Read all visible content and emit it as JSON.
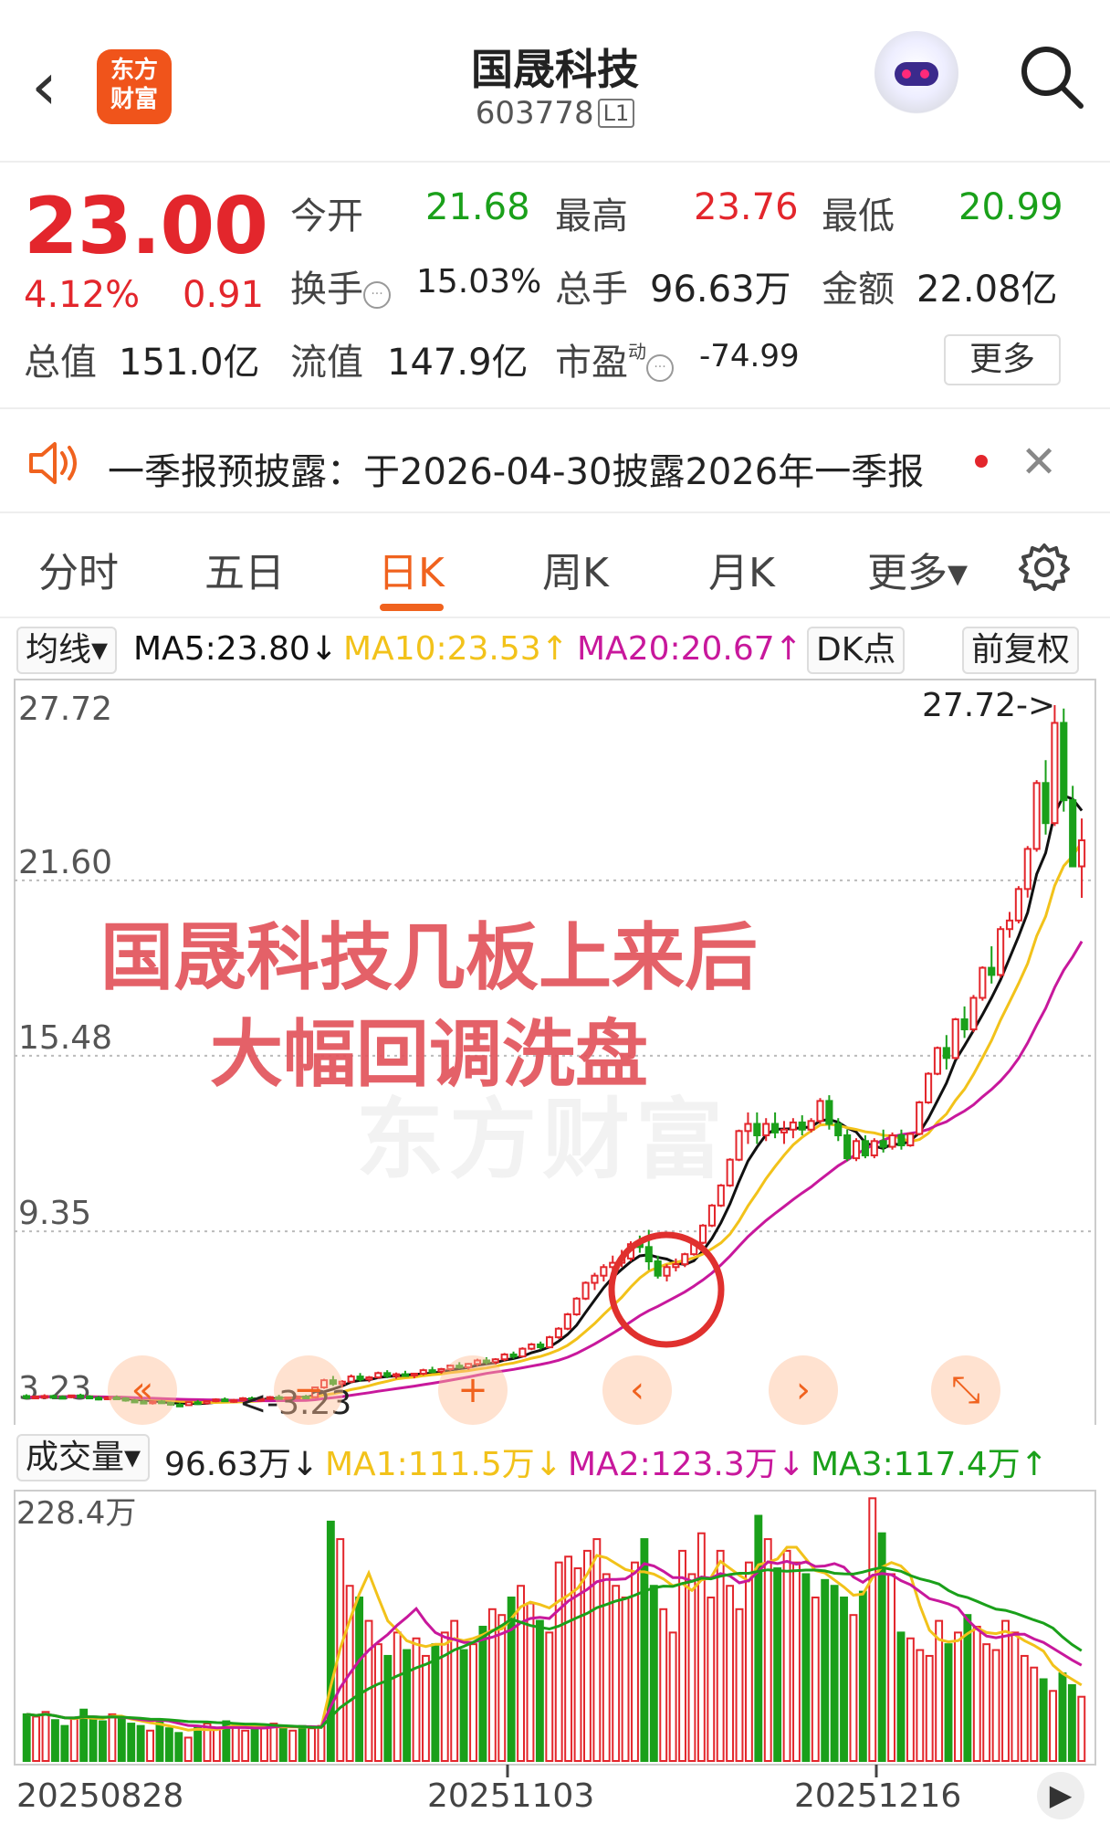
{
  "header": {
    "back_glyph": "‹",
    "logo_line1": "东方",
    "logo_line2": "财富",
    "title": "国晟科技",
    "code": "603778",
    "level": "L1"
  },
  "quote": {
    "price": "23.00",
    "change_pct": "4.12%",
    "change_amt": "0.91",
    "open_label": "今开",
    "open": "21.68",
    "high_label": "最高",
    "high": "23.76",
    "low_label": "最低",
    "low": "20.99",
    "turnover_label": "换手",
    "turnover": "15.03%",
    "volume_label": "总手",
    "volume": "96.63万",
    "amount_label": "金额",
    "amount": "22.08亿",
    "mktcap_label": "总值",
    "mktcap": "151.0亿",
    "float_label": "流值",
    "float_cap": "147.9亿",
    "pe_label": "市盈",
    "pe_sup": "动",
    "pe": "-74.99",
    "more_label": "更多"
  },
  "notice": {
    "text": "一季报预披露：于2026-04-30披露2026年一季报"
  },
  "tabs": [
    {
      "label": "分时"
    },
    {
      "label": "五日"
    },
    {
      "label": "日K"
    },
    {
      "label": "周K"
    },
    {
      "label": "月K"
    },
    {
      "label": "更多▾"
    }
  ],
  "ma_bar": {
    "avg_label": "均线▾",
    "ma5": "MA5:23.80↓",
    "ma10": "MA10:23.53↑",
    "ma20": "MA20:20.67↑",
    "dk": "DK点",
    "adjust": "前复权"
  },
  "vol_bar": {
    "label": "成交量▾",
    "vol": "96.63万↓",
    "ma1": "MA1:111.5万↓",
    "ma2": "MA2:123.3万↓",
    "ma3": "MA3:117.4万↑"
  },
  "colors": {
    "up": "#e3262c",
    "down": "#1aa01a",
    "ma5": "#111111",
    "ma10": "#f2c21a",
    "ma20": "#c8189c",
    "accent": "#f0621e"
  },
  "annotation": {
    "line1": "国晟科技几板上来后",
    "line2": "大幅回调洗盘"
  },
  "watermark": "东方财富",
  "controls": [
    "«",
    "−",
    "+",
    "‹",
    "›",
    "⤡"
  ],
  "chart_data": [
    {
      "type": "candlestick",
      "y_ticks": [
        "27.72",
        "21.60",
        "15.48",
        "9.35",
        "3.23"
      ],
      "ylim": [
        3.23,
        27.72
      ],
      "max_marker": "27.72->",
      "min_marker": "<-3.23",
      "x_ticks": [
        "20250828",
        "20251103",
        "20251216"
      ],
      "ohlc": [
        [
          3.6,
          3.66,
          3.48,
          3.55
        ],
        [
          3.55,
          3.62,
          3.5,
          3.58
        ],
        [
          3.58,
          3.66,
          3.52,
          3.6
        ],
        [
          3.6,
          3.65,
          3.54,
          3.57
        ],
        [
          3.57,
          3.62,
          3.5,
          3.56
        ],
        [
          3.56,
          3.64,
          3.52,
          3.62
        ],
        [
          3.62,
          3.68,
          3.55,
          3.58
        ],
        [
          3.58,
          3.63,
          3.5,
          3.54
        ],
        [
          3.54,
          3.6,
          3.45,
          3.5
        ],
        [
          3.5,
          3.58,
          3.46,
          3.55
        ],
        [
          3.55,
          3.62,
          3.48,
          3.52
        ],
        [
          3.52,
          3.56,
          3.4,
          3.44
        ],
        [
          3.44,
          3.5,
          3.36,
          3.4
        ],
        [
          3.4,
          3.46,
          3.32,
          3.37
        ],
        [
          3.37,
          3.44,
          3.3,
          3.41
        ],
        [
          3.41,
          3.46,
          3.33,
          3.36
        ],
        [
          3.36,
          3.4,
          3.26,
          3.3
        ],
        [
          3.3,
          3.36,
          3.23,
          3.28
        ],
        [
          3.28,
          3.4,
          3.26,
          3.38
        ],
        [
          3.38,
          3.46,
          3.32,
          3.35
        ],
        [
          3.35,
          3.44,
          3.3,
          3.42
        ],
        [
          3.42,
          3.52,
          3.38,
          3.48
        ],
        [
          3.48,
          3.55,
          3.4,
          3.44
        ],
        [
          3.44,
          3.5,
          3.36,
          3.46
        ],
        [
          3.46,
          3.56,
          3.42,
          3.52
        ],
        [
          3.52,
          3.58,
          3.44,
          3.47
        ],
        [
          3.47,
          3.54,
          3.4,
          3.5
        ],
        [
          3.5,
          3.6,
          3.46,
          3.56
        ],
        [
          3.56,
          3.64,
          3.5,
          3.52
        ],
        [
          3.52,
          3.58,
          3.46,
          3.55
        ],
        [
          3.55,
          3.62,
          3.5,
          3.58
        ],
        [
          3.58,
          3.64,
          3.52,
          3.56
        ],
        [
          3.56,
          3.9,
          3.54,
          3.9
        ],
        [
          3.9,
          4.2,
          3.85,
          4.15
        ],
        [
          4.15,
          4.3,
          3.95,
          4.02
        ],
        [
          4.02,
          4.15,
          3.9,
          4.1
        ],
        [
          4.1,
          4.35,
          4.05,
          4.28
        ],
        [
          4.28,
          4.4,
          4.1,
          4.18
        ],
        [
          4.18,
          4.3,
          4.08,
          4.25
        ],
        [
          4.25,
          4.45,
          4.2,
          4.4
        ],
        [
          4.4,
          4.5,
          4.22,
          4.3
        ],
        [
          4.3,
          4.42,
          4.2,
          4.36
        ],
        [
          4.36,
          4.48,
          4.28,
          4.32
        ],
        [
          4.32,
          4.4,
          4.22,
          4.38
        ],
        [
          4.38,
          4.55,
          4.32,
          4.5
        ],
        [
          4.5,
          4.62,
          4.4,
          4.46
        ],
        [
          4.46,
          4.58,
          4.38,
          4.54
        ],
        [
          4.54,
          4.7,
          4.48,
          4.66
        ],
        [
          4.66,
          4.78,
          4.55,
          4.6
        ],
        [
          4.6,
          4.75,
          4.52,
          4.72
        ],
        [
          4.72,
          4.9,
          4.65,
          4.84
        ],
        [
          4.84,
          4.95,
          4.7,
          4.78
        ],
        [
          4.78,
          4.92,
          4.7,
          4.88
        ],
        [
          4.88,
          5.1,
          4.82,
          5.05
        ],
        [
          5.05,
          5.15,
          4.9,
          4.98
        ],
        [
          4.98,
          5.3,
          4.95,
          5.25
        ],
        [
          5.25,
          5.45,
          5.2,
          5.4
        ],
        [
          5.4,
          5.5,
          5.22,
          5.3
        ],
        [
          5.3,
          5.7,
          5.28,
          5.65
        ],
        [
          5.65,
          6.0,
          5.6,
          5.95
        ],
        [
          5.95,
          6.5,
          5.9,
          6.45
        ],
        [
          6.45,
          7.05,
          6.4,
          7.0
        ],
        [
          7.0,
          7.6,
          6.95,
          7.55
        ],
        [
          7.55,
          7.9,
          7.3,
          7.8
        ],
        [
          7.8,
          8.2,
          7.6,
          8.1
        ],
        [
          8.1,
          8.5,
          7.85,
          8.25
        ],
        [
          8.25,
          8.7,
          8.1,
          8.4
        ],
        [
          8.4,
          9.0,
          8.3,
          8.9
        ],
        [
          8.9,
          9.2,
          8.6,
          8.8
        ],
        [
          8.8,
          9.4,
          8.0,
          8.3
        ],
        [
          8.3,
          8.5,
          7.7,
          7.8
        ],
        [
          7.8,
          8.2,
          7.6,
          8.1
        ],
        [
          8.1,
          8.4,
          7.95,
          8.2
        ],
        [
          8.2,
          8.6,
          8.1,
          8.55
        ],
        [
          8.55,
          9.0,
          8.5,
          8.95
        ],
        [
          8.95,
          9.6,
          8.9,
          9.55
        ],
        [
          9.55,
          10.3,
          9.5,
          10.25
        ],
        [
          10.25,
          11.0,
          10.2,
          10.95
        ],
        [
          10.95,
          11.9,
          10.9,
          11.85
        ],
        [
          11.85,
          12.9,
          11.8,
          12.85
        ],
        [
          12.85,
          13.5,
          12.4,
          13.1
        ],
        [
          13.1,
          13.5,
          12.4,
          12.7
        ],
        [
          12.7,
          13.3,
          12.5,
          13.1
        ],
        [
          13.1,
          13.5,
          12.6,
          12.8
        ],
        [
          12.8,
          13.2,
          12.4,
          12.9
        ],
        [
          12.9,
          13.3,
          12.6,
          13.15
        ],
        [
          13.15,
          13.4,
          12.7,
          12.9
        ],
        [
          12.9,
          13.3,
          12.8,
          13.2
        ],
        [
          13.2,
          14.0,
          13.1,
          13.9
        ],
        [
          13.9,
          14.1,
          12.9,
          13.1
        ],
        [
          13.1,
          13.3,
          12.5,
          12.7
        ],
        [
          12.7,
          12.9,
          11.8,
          11.9
        ],
        [
          11.9,
          12.6,
          11.8,
          12.5
        ],
        [
          12.5,
          12.7,
          11.9,
          12.0
        ],
        [
          12.0,
          12.6,
          11.9,
          12.5
        ],
        [
          12.5,
          12.9,
          12.1,
          12.3
        ],
        [
          12.3,
          12.8,
          12.2,
          12.7
        ],
        [
          12.7,
          12.9,
          12.2,
          12.35
        ],
        [
          12.35,
          12.8,
          12.3,
          12.75
        ],
        [
          12.75,
          13.9,
          12.7,
          13.85
        ],
        [
          13.85,
          14.9,
          13.8,
          14.85
        ],
        [
          14.85,
          15.8,
          14.8,
          15.75
        ],
        [
          15.75,
          16.2,
          15.0,
          15.4
        ],
        [
          15.4,
          16.8,
          15.35,
          16.75
        ],
        [
          16.75,
          17.2,
          16.1,
          16.4
        ],
        [
          16.4,
          17.6,
          16.3,
          17.5
        ],
        [
          17.5,
          18.6,
          17.4,
          18.55
        ],
        [
          18.55,
          19.3,
          18.0,
          18.3
        ],
        [
          18.3,
          20.0,
          18.2,
          19.9
        ],
        [
          19.9,
          20.5,
          19.6,
          20.2
        ],
        [
          20.2,
          21.4,
          20.1,
          21.3
        ],
        [
          21.3,
          22.8,
          21.0,
          22.7
        ],
        [
          22.7,
          25.1,
          22.6,
          25.0
        ],
        [
          25.0,
          25.8,
          23.2,
          23.6
        ],
        [
          23.6,
          27.72,
          23.5,
          27.1
        ],
        [
          27.1,
          27.6,
          24.0,
          24.4
        ],
        [
          24.4,
          24.9,
          22.6,
          22.09
        ],
        [
          22.09,
          23.76,
          20.99,
          23.0
        ]
      ],
      "ma5_end": 23.8,
      "ma10_end": 23.53,
      "ma20_end": 20.67
    },
    {
      "type": "bar",
      "unit": "万",
      "y_ticks": [
        "228.4万"
      ],
      "ylim": [
        0,
        228.4
      ],
      "volumes": [
        40,
        38,
        42,
        35,
        30,
        36,
        44,
        38,
        34,
        40,
        36,
        32,
        30,
        26,
        34,
        28,
        24,
        20,
        30,
        32,
        28,
        34,
        30,
        26,
        30,
        28,
        32,
        30,
        26,
        30,
        28,
        30,
        205,
        190,
        150,
        140,
        120,
        100,
        90,
        110,
        95,
        105,
        90,
        100,
        110,
        120,
        95,
        100,
        115,
        130,
        125,
        140,
        150,
        135,
        120,
        110,
        170,
        175,
        165,
        180,
        190,
        160,
        150,
        140,
        170,
        190,
        150,
        130,
        110,
        180,
        160,
        195,
        140,
        180,
        150,
        130,
        170,
        210,
        190,
        165,
        180,
        170,
        160,
        140,
        155,
        150,
        140,
        125,
        145,
        225,
        195,
        160,
        110,
        105,
        95,
        90,
        120,
        100,
        110,
        125,
        115,
        100,
        95,
        120,
        110,
        90,
        80,
        70,
        60,
        75,
        65,
        55
      ]
    }
  ]
}
